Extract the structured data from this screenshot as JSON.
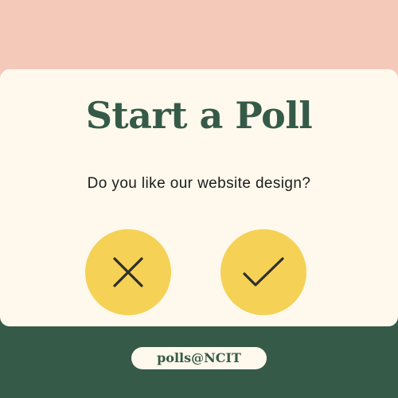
{
  "poll": {
    "title": "Start a Poll",
    "question": "Do you like our website design?"
  },
  "buttons": {
    "no_icon": "close-icon",
    "yes_icon": "check-icon"
  },
  "footer": {
    "handle": "polls@NCIT"
  },
  "colors": {
    "top_band": "#f5c9b9",
    "bottom_band": "#365a48",
    "card": "#fef9ec",
    "accent": "#f5d155",
    "title": "#365a48",
    "icon": "#2e2e2e"
  }
}
